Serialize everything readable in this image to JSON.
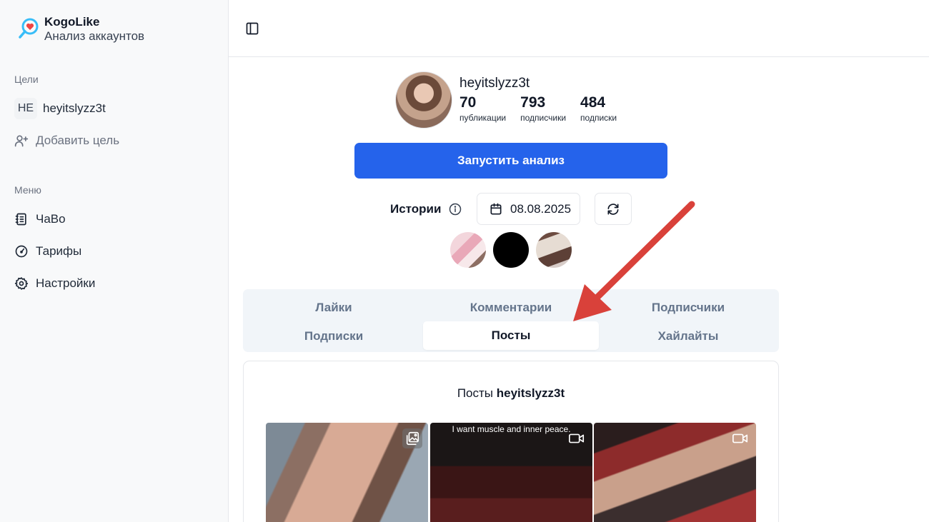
{
  "brand": {
    "name": "KogoLike",
    "subtitle": "Анализ аккаунтов"
  },
  "sidebar": {
    "targets_label": "Цели",
    "targets": [
      {
        "initials": "HE",
        "name": "heyitslyzz3t"
      }
    ],
    "add_target": "Добавить цель",
    "menu_label": "Меню",
    "menu": [
      {
        "label": "ЧаВо",
        "icon": "notebook-icon"
      },
      {
        "label": "Тарифы",
        "icon": "gauge-icon"
      },
      {
        "label": "Настройки",
        "icon": "gear-icon"
      }
    ]
  },
  "profile": {
    "username": "heyitslyzz3t",
    "stats": [
      {
        "value": "70",
        "label": "публикации"
      },
      {
        "value": "793",
        "label": "подписчики"
      },
      {
        "value": "484",
        "label": "подписки"
      }
    ]
  },
  "run_button": "Запустить анализ",
  "stories": {
    "label": "Истории",
    "date": "08.08.2025"
  },
  "tabs": [
    {
      "label": "Лайки",
      "active": false
    },
    {
      "label": "Комментарии",
      "active": false
    },
    {
      "label": "Подписчики",
      "active": false
    },
    {
      "label": "Подписки",
      "active": false
    },
    {
      "label": "Посты",
      "active": true
    },
    {
      "label": "Хайлайты",
      "active": false
    }
  ],
  "posts_section": {
    "title_prefix": "Посты",
    "username": "heyitslyzz3t",
    "posts": [
      {
        "type_icon": "gallery-icon",
        "caption": ""
      },
      {
        "type_icon": "video-icon",
        "caption": "I want muscle and inner peace."
      },
      {
        "type_icon": "video-icon",
        "caption": ""
      }
    ]
  },
  "colors": {
    "primary": "#2563eb",
    "arrow": "#d9413a"
  }
}
